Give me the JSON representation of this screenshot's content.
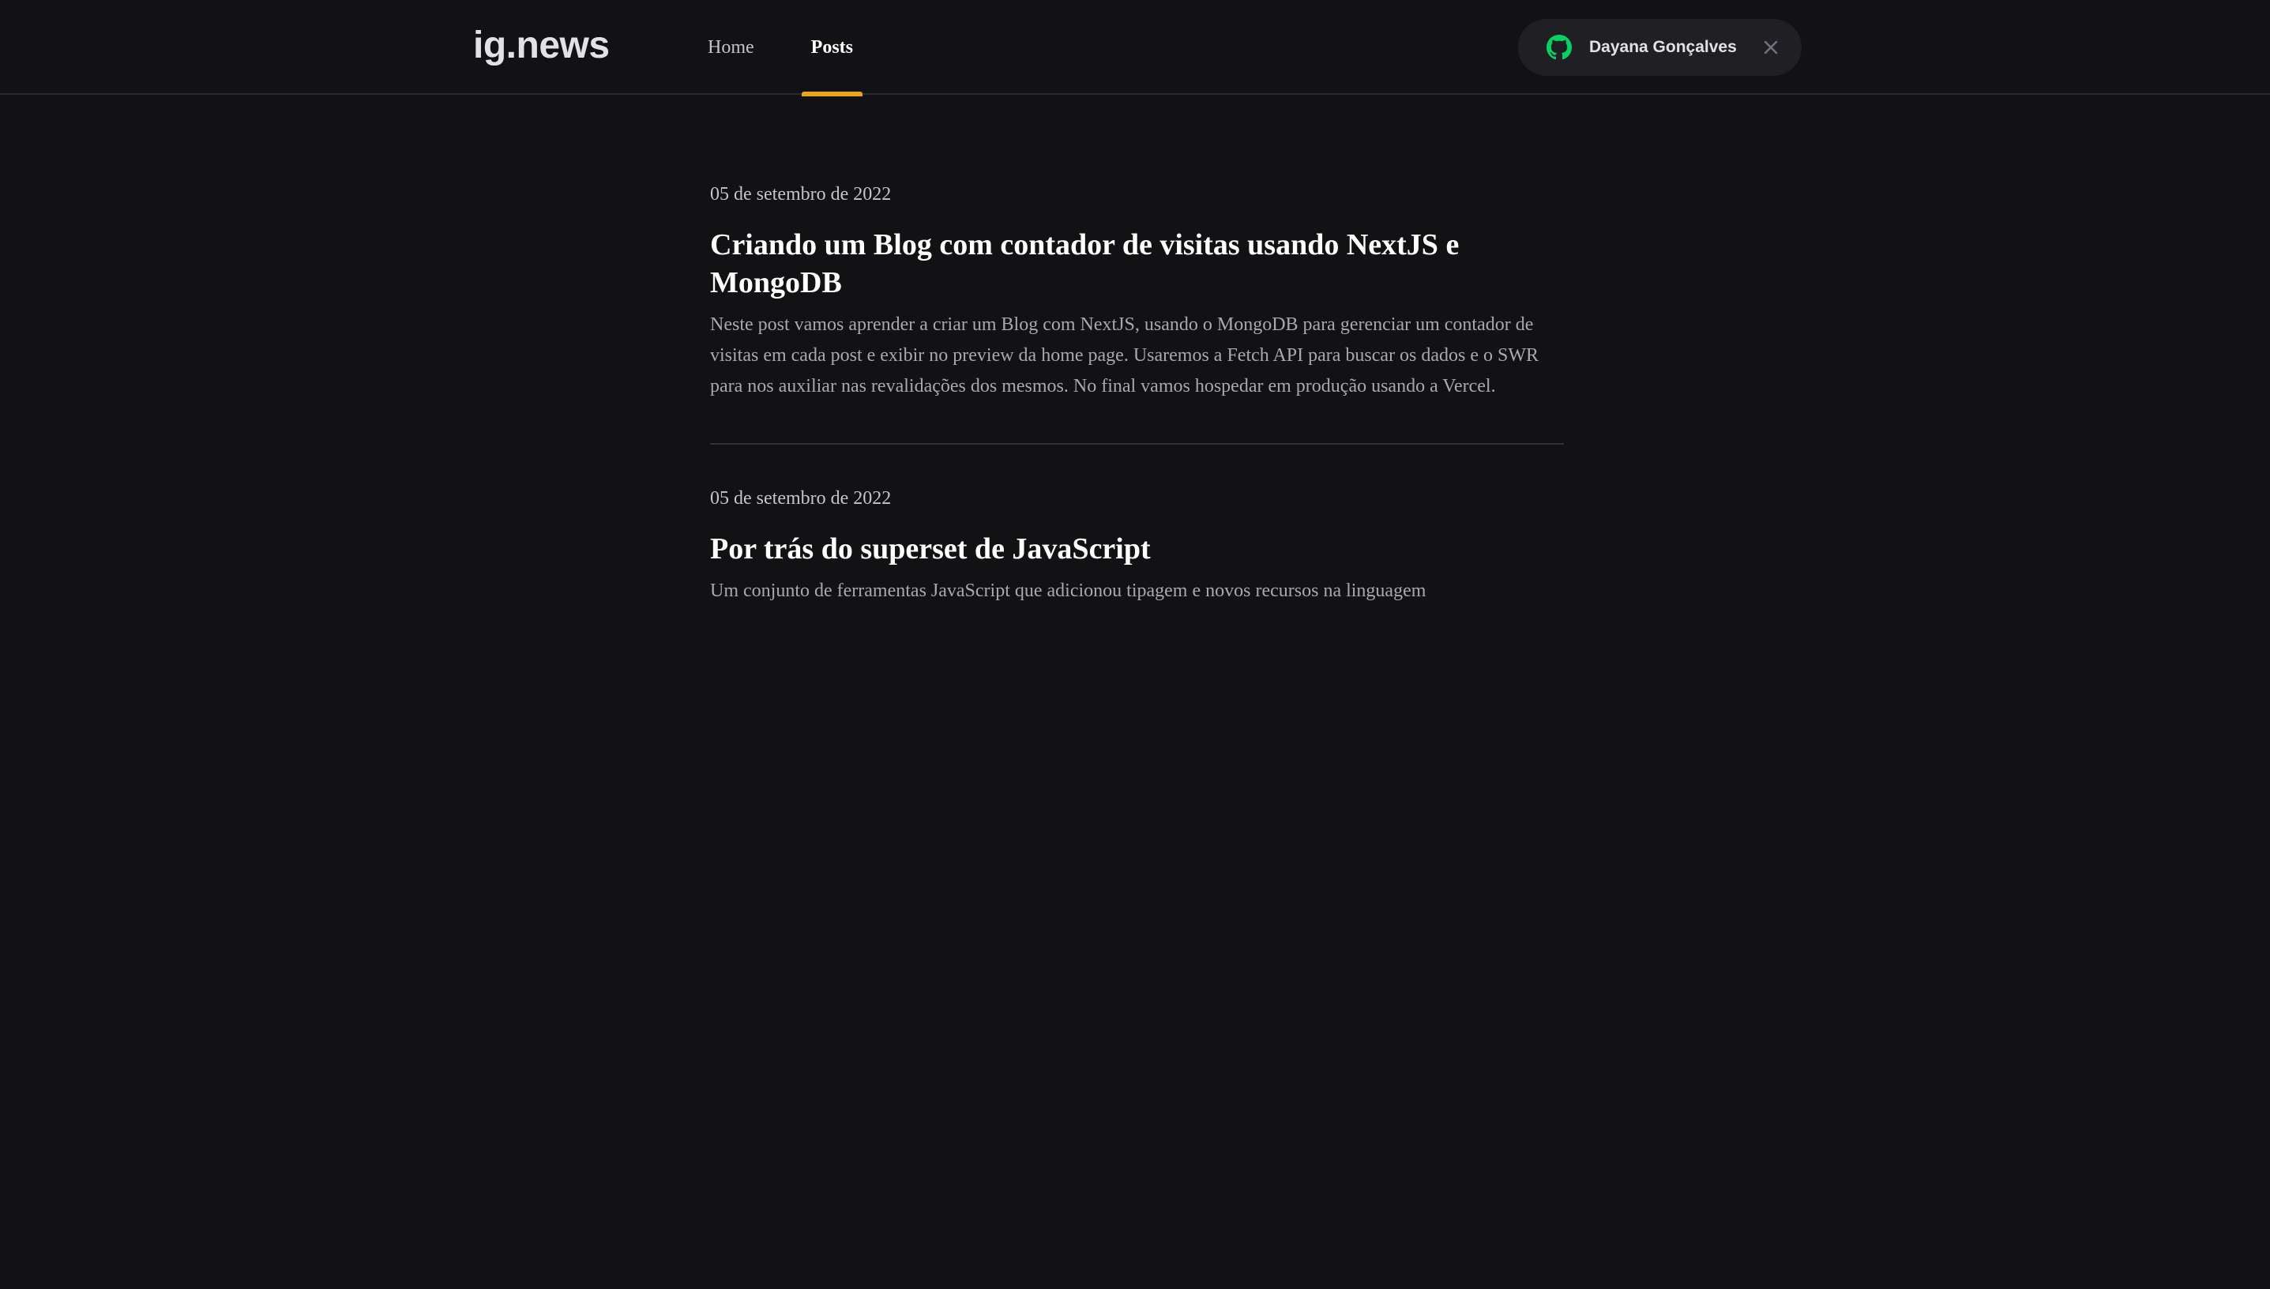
{
  "header": {
    "logo": "ig.news",
    "nav": {
      "home": "Home",
      "posts": "Posts"
    },
    "user": {
      "name": "Dayana Gonçalves",
      "icon": "github-icon",
      "close_icon": "close-icon"
    }
  },
  "colors": {
    "background": "#121214",
    "accent": "#eba417",
    "github_green": "#04d361"
  },
  "posts": [
    {
      "date": "05 de setembro de 2022",
      "title": "Criando um Blog com contador de visitas usando NextJS e MongoDB",
      "excerpt": "Neste post vamos aprender a criar um Blog com NextJS, usando o MongoDB para gerenciar um contador de visitas em cada post e exibir no preview da home page. Usaremos a Fetch API para buscar os dados e o SWR para nos auxiliar nas revalidações dos mesmos. No final vamos hospedar em produção usando a Vercel."
    },
    {
      "date": "05 de setembro de 2022",
      "title": "Por trás do superset de JavaScript",
      "excerpt": "Um conjunto de ferramentas JavaScript que adicionou tipagem e novos recursos na linguagem"
    }
  ]
}
